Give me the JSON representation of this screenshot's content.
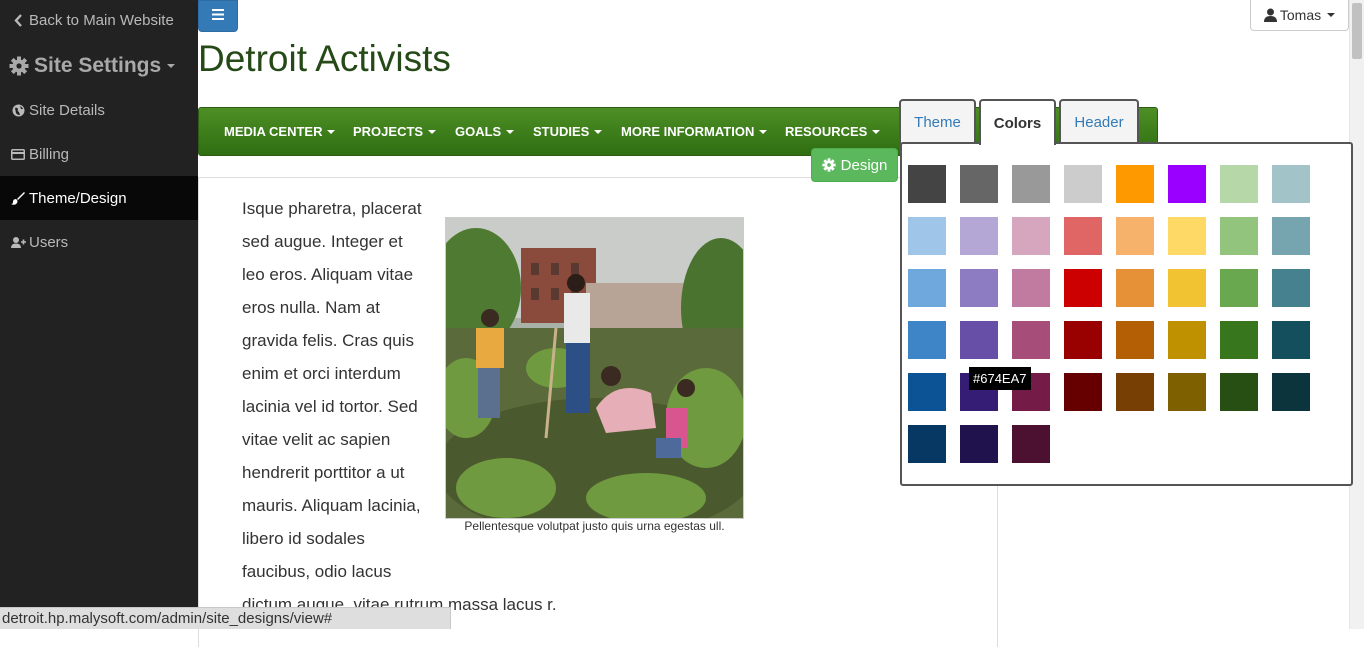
{
  "sidebar": {
    "back_label": "Back to Main Website",
    "settings_label": "Site Settings",
    "items": [
      {
        "label": "Site Details",
        "icon": "globe-icon"
      },
      {
        "label": "Billing",
        "icon": "credit-card-icon"
      },
      {
        "label": "Theme/Design",
        "icon": "brush-icon",
        "active": true
      },
      {
        "label": "Users",
        "icon": "add-user-icon"
      }
    ]
  },
  "header": {
    "menu_icon": "hamburger-icon",
    "user_label": "Tomas",
    "site_title": "Detroit Activists"
  },
  "main_nav": {
    "items": [
      "MEDIA CENTER",
      "PROJECTS",
      "GOALS",
      "STUDIES",
      "MORE INFORMATION",
      "RESOURCES"
    ]
  },
  "design_button": {
    "label": "Design",
    "icon": "gear-icon"
  },
  "content": {
    "lines": [
      "Isque pharetra, placerat",
      "sed augue. Integer et",
      "leo eros. Aliquam vitae",
      "eros nulla. Nam at",
      "gravida felis. Cras quis",
      "enim et orci interdum",
      "lacinia vel id tortor. Sed",
      "vitae velit ac sapien",
      "hendrerit porttitor a ut",
      "mauris. Aliquam lacinia,",
      "libero id sodales",
      "faucibus, odio lacus"
    ],
    "last_line": "dictum augue, vitae rutrum massa lacus r.",
    "caption": "Pellentesque volutpat justo quis urna egestas ull."
  },
  "popover": {
    "tabs": [
      "Theme",
      "Colors",
      "Header"
    ],
    "active_tab": "Colors",
    "swatches": [
      [
        "#444444",
        "#666666",
        "#999999",
        "#cccccc",
        "#ff9900",
        "#9900ff",
        "#b6d7a8",
        "#a2c4c9"
      ],
      [
        "#9fc5e8",
        "#b4a7d6",
        "#d5a6bd",
        "#e06666",
        "#f6b26b",
        "#ffd966",
        "#93c47d",
        "#76a5af"
      ],
      [
        "#6fa8dc",
        "#8e7cc3",
        "#c27ba0",
        "#cc0000",
        "#e69138",
        "#f1c232",
        "#6aa84f",
        "#45818e"
      ],
      [
        "#3d85c6",
        "#674ea7",
        "#a64d79",
        "#990000",
        "#b45f06",
        "#bf9000",
        "#38761d",
        "#134f5c"
      ],
      [
        "#0b5394",
        "#351c75",
        "#741b47",
        "#660000",
        "#783f04",
        "#7f6000",
        "#274e13",
        "#0c343d"
      ],
      [
        "#073763",
        "#20124d",
        "#4c1130"
      ]
    ],
    "tooltip": "#674EA7"
  },
  "status_bar": {
    "url": "detroit.hp.malysoft.com/admin/site_designs/view#"
  }
}
